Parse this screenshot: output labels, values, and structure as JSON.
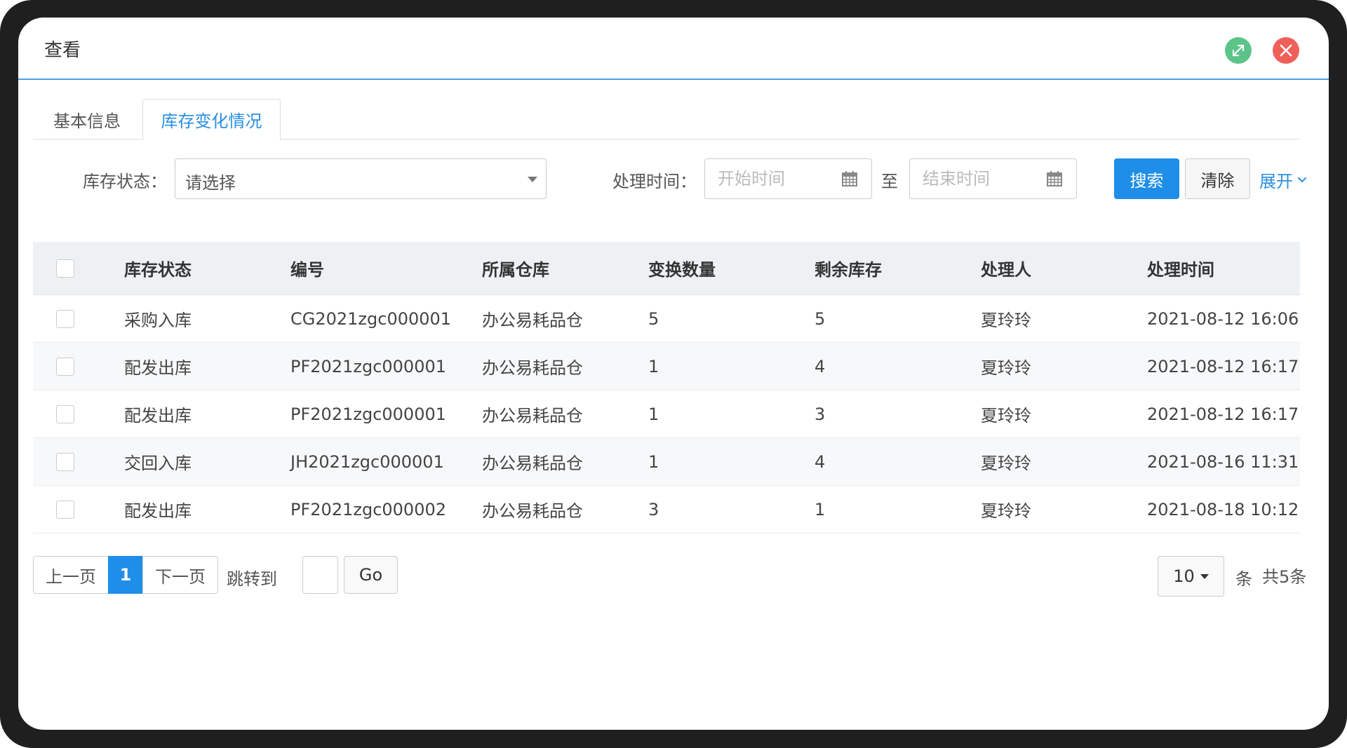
{
  "dialog": {
    "title": "查看"
  },
  "header": {
    "expand_icon": "expand-arrows-icon",
    "close_icon": "close-x-icon",
    "colors": {
      "expand": "#5cc489",
      "close": "#f0605a",
      "accent": "#1e8ee8"
    }
  },
  "tabs": [
    {
      "label": "基本信息",
      "active": false
    },
    {
      "label": "库存变化情况",
      "active": true
    }
  ],
  "filters": {
    "status_label": "库存状态：",
    "status_placeholder": "请选择",
    "time_label": "处理时间：",
    "start_placeholder": "开始时间",
    "separator": "至",
    "end_placeholder": "结束时间",
    "search_label": "搜索",
    "clear_label": "清除",
    "expand_label": "展开"
  },
  "table": {
    "headers": [
      "库存状态",
      "编号",
      "所属仓库",
      "变换数量",
      "剩余库存",
      "处理人",
      "处理时间"
    ],
    "rows": [
      [
        "采购入库",
        "CG2021zgc000001",
        "办公易耗品仓",
        "5",
        "5",
        "夏玲玲",
        "2021-08-12 16:06"
      ],
      [
        "配发出库",
        "PF2021zgc000001",
        "办公易耗品仓",
        "1",
        "4",
        "夏玲玲",
        "2021-08-12 16:17"
      ],
      [
        "配发出库",
        "PF2021zgc000001",
        "办公易耗品仓",
        "1",
        "3",
        "夏玲玲",
        "2021-08-12 16:17"
      ],
      [
        "交回入库",
        "JH2021zgc000001",
        "办公易耗品仓",
        "1",
        "4",
        "夏玲玲",
        "2021-08-16 11:31"
      ],
      [
        "配发出库",
        "PF2021zgc000002",
        "办公易耗品仓",
        "3",
        "1",
        "夏玲玲",
        "2021-08-18 10:12"
      ]
    ]
  },
  "pagination": {
    "prev_label": "上一页",
    "current_page": "1",
    "next_label": "下一页",
    "jump_label": "跳转到",
    "go_label": "Go",
    "page_size": "10",
    "unit_label": "条",
    "total_label": "共5条"
  }
}
